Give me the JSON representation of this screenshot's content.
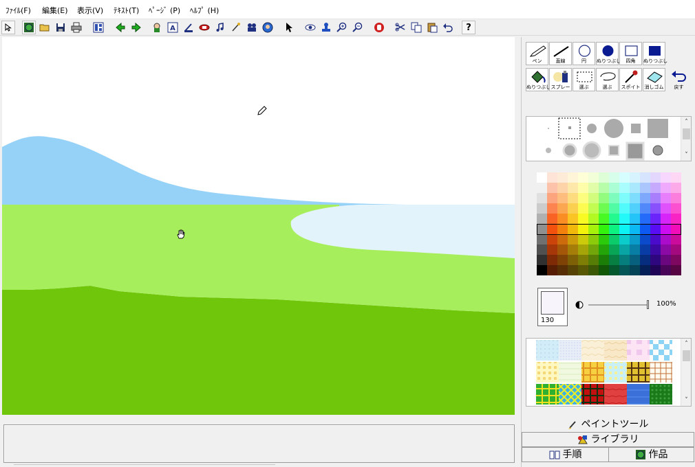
{
  "menu": {
    "file": "ﾌｧｲﾙ(F)",
    "edit": "編集(E)",
    "view": "表示(V)",
    "text": "ﾃｷｽﾄ(T)",
    "page": "ﾍﾟｰｼﾞ (P)",
    "help": "ﾍﾙﾌﾟ (H)"
  },
  "toolbar": {
    "help_label": "?"
  },
  "tools": {
    "pen": "ペン",
    "line": "直線",
    "circle": "円",
    "circle_fill": "ぬりつぶし",
    "rect": "四角",
    "rect_fill": "ぬりつぶし",
    "fill": "ぬりつぶし",
    "spray": "スプレー",
    "select_rect": "選ぶ",
    "select_lasso": "選ぶ",
    "dropper": "スポイト",
    "eraser": "消しゴム",
    "undo": "戻す"
  },
  "color": {
    "current_value": "130",
    "opacity": "100%",
    "current_hex": "#f8f4fc"
  },
  "tabs": {
    "paint_tool": "ペイントツール",
    "library": "ライブラリ",
    "steps": "手順",
    "works": "作品"
  },
  "icons": {
    "menu": [
      "arrow-cursor-icon",
      "globe-icon",
      "open-folder-icon",
      "save-disk-icon",
      "print-icon",
      "layout-icon",
      "back-arrow-icon",
      "forward-arrow-icon",
      "character-icon",
      "text-box-icon",
      "stamp-icon",
      "eraser-icon",
      "music-icon",
      "brush-icon",
      "movie-icon",
      "globe-person-icon",
      "pointer-icon",
      "eye-icon",
      "stamp-tool-icon",
      "zoom-in-icon",
      "zoom-out-icon",
      "stop-hand-icon",
      "scissors-icon",
      "copy-icon",
      "paste-icon",
      "undo-icon",
      "help-icon"
    ]
  }
}
